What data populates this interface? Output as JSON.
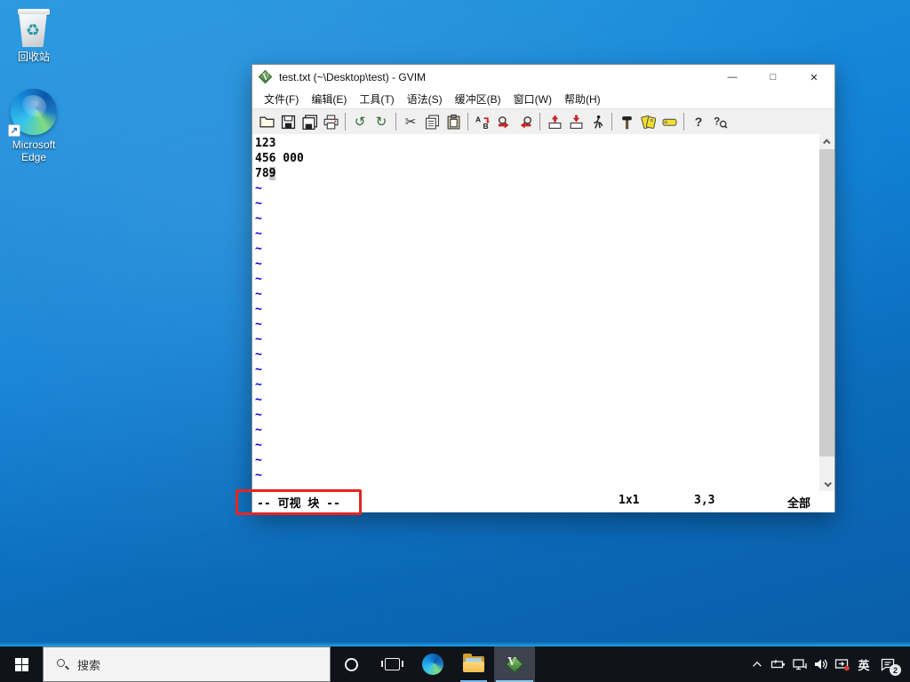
{
  "desktop": {
    "icons": [
      {
        "label": "回收站"
      },
      {
        "label": "Microsoft Edge"
      }
    ]
  },
  "window": {
    "title": "test.txt (~\\Desktop\\test) - GVIM",
    "controls": {
      "minimize": "—",
      "maximize": "□",
      "close": "✕"
    },
    "menu": {
      "items": [
        "文件(F)",
        "编辑(E)",
        "工具(T)",
        "语法(S)",
        "缓冲区(B)",
        "窗口(W)",
        "帮助(H)"
      ]
    },
    "toolbar": {
      "buttons": [
        "open",
        "save",
        "save-all",
        "print",
        "undo",
        "redo",
        "cut",
        "copy",
        "paste",
        "find-replace",
        "find-next",
        "find-previous",
        "load-session",
        "save-session",
        "run-script",
        "make",
        "build-tags",
        "jump-to-tag",
        "help",
        "find-in-help"
      ],
      "undo_glyph": "↺",
      "redo_glyph": "↻",
      "cut_glyph": "✂",
      "help_glyph": "?"
    },
    "editor": {
      "line1": "123",
      "line2": "456 000",
      "line3_before": "78",
      "line3_selected": "9",
      "tilde_char": "~",
      "tilde_count": 20
    },
    "statusbar": {
      "mode": "-- 可视 块 --",
      "selection_size": "1x1",
      "position": "3,3",
      "scroll": "全部"
    }
  },
  "annotation": {
    "shape": "red-rectangle",
    "color": "#e8241f"
  },
  "taskbar": {
    "search_placeholder": "搜索",
    "apps": [
      "start",
      "search",
      "cortana",
      "task-view",
      "edge",
      "file-explorer",
      "gvim"
    ],
    "tray": {
      "icons": [
        "hidden-icons-chevron",
        "battery",
        "network",
        "volume",
        "cast",
        "ime",
        "notifications"
      ],
      "ime_label": "英",
      "notification_count": "2"
    }
  }
}
